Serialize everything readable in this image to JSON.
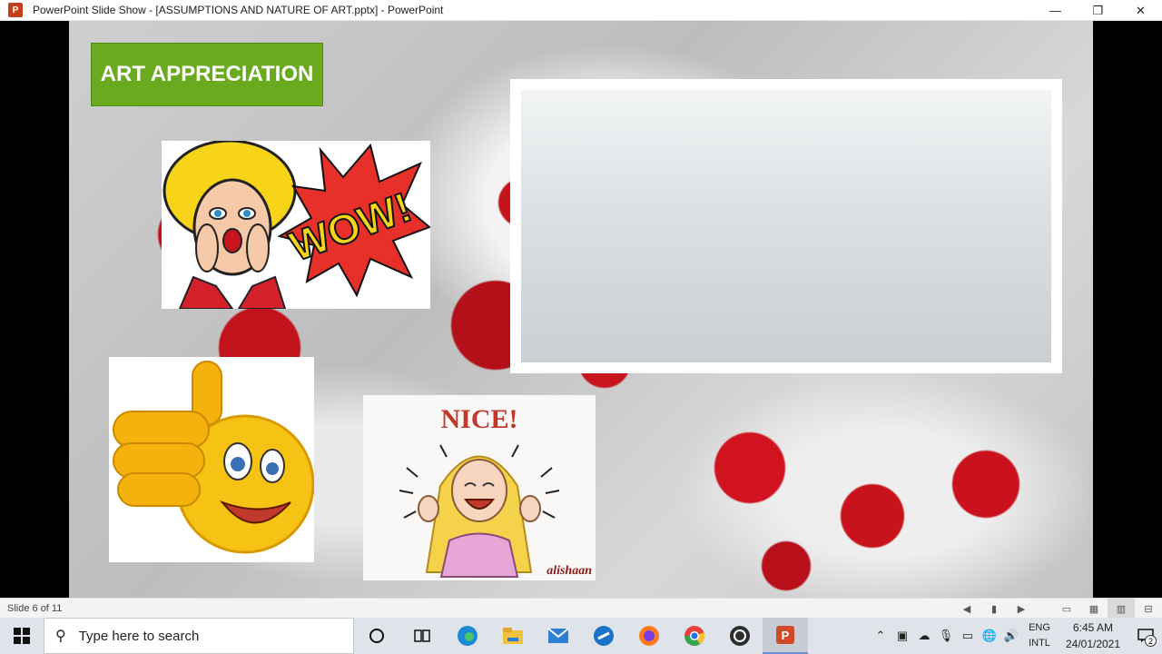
{
  "window": {
    "app_icon": "P",
    "title": "PowerPoint Slide Show - [ASSUMPTIONS AND NATURE OF ART.pptx] - PowerPoint",
    "minimize": "—",
    "restore": "❐",
    "close": "✕"
  },
  "slide": {
    "title": "ART APPRECIATION",
    "nice_caption": "NICE!",
    "wow_caption": "WOW!",
    "signature": "alishaan",
    "colors": {
      "title_bg": "#6aaa1e",
      "berry": "#c8121c"
    }
  },
  "statusbar": {
    "slide_counter": "Slide 6 of 11"
  },
  "taskbar": {
    "search_placeholder": "Type here to search",
    "apps": [
      "cortana-icon",
      "task-view-icon",
      "edge-icon",
      "file-explorer-icon",
      "mail-icon",
      "vpn-icon",
      "firefox-icon",
      "chrome-icon",
      "obs-icon",
      "powerpoint-icon"
    ],
    "lang_top": "ENG",
    "lang_bottom": "INTL",
    "time": "6:45 AM",
    "date": "24/01/2021",
    "notification_count": "2"
  }
}
